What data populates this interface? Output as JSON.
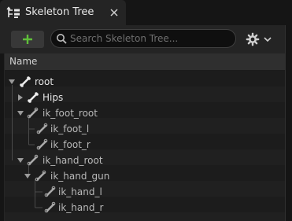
{
  "tab": {
    "title": "Skeleton Tree",
    "icon": "skeleton-tree-icon",
    "close_icon": "close-icon"
  },
  "toolbar": {
    "add_icon": "plus-icon",
    "search": {
      "placeholder": "Search Skeleton Tree...",
      "value": ""
    },
    "settings_icon": "gear-icon",
    "dropdown_icon": "chevron-down-icon"
  },
  "column_header": {
    "name": "Name"
  },
  "tree": {
    "nodes": [
      {
        "label": "root",
        "expanded": true,
        "icon": "bone-icon"
      },
      {
        "label": "Hips",
        "expanded": false,
        "icon": "bone-icon"
      },
      {
        "label": "ik_foot_root",
        "expanded": true,
        "icon": "bone-icon"
      },
      {
        "label": "ik_foot_l",
        "icon": "bone-icon"
      },
      {
        "label": "ik_foot_r",
        "icon": "bone-icon"
      },
      {
        "label": "ik_hand_root",
        "expanded": true,
        "icon": "bone-icon"
      },
      {
        "label": "ik_hand_gun",
        "expanded": true,
        "icon": "bone-icon"
      },
      {
        "label": "ik_hand_l",
        "icon": "bone-icon"
      },
      {
        "label": "ik_hand_r",
        "icon": "bone-icon"
      }
    ]
  },
  "colors": {
    "accent_add": "#5fbf3a",
    "background": "#151515",
    "panel": "#242424",
    "text": "#e6e6e6"
  }
}
